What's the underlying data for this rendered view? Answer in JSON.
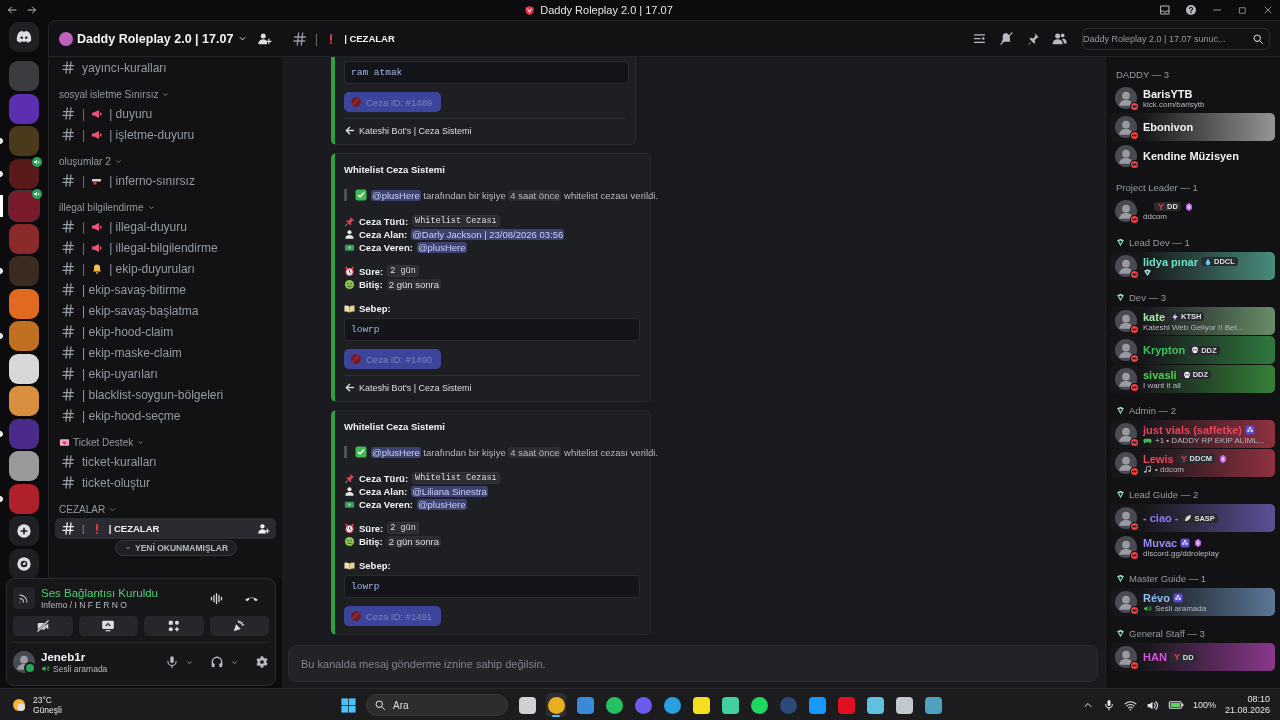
{
  "window": {
    "title": "Daddy Roleplay 2.0 | 17.07"
  },
  "servers": [
    {
      "kind": "home",
      "selected": false,
      "unread": false,
      "voice": false
    },
    {
      "kind": "server",
      "color": "#3c3c40",
      "selected": false,
      "unread": false,
      "voice": false
    },
    {
      "kind": "server",
      "color": "#5b2fb0",
      "selected": false,
      "unread": false,
      "voice": false
    },
    {
      "kind": "server",
      "color": "#4a3a1c",
      "selected": false,
      "unread": true,
      "voice": false
    },
    {
      "kind": "server",
      "color": "#5a1a1a",
      "selected": false,
      "unread": true,
      "voice": true
    },
    {
      "kind": "server",
      "color": "#7a1a2a",
      "selected": true,
      "unread": false,
      "voice": true
    },
    {
      "kind": "server",
      "color": "#8a2a2a",
      "selected": false,
      "unread": false,
      "voice": false
    },
    {
      "kind": "server",
      "color": "#3a2a20",
      "selected": false,
      "unread": true,
      "voice": false
    },
    {
      "kind": "server",
      "color": "#e06a20",
      "selected": false,
      "unread": false,
      "voice": false
    },
    {
      "kind": "server",
      "color": "#c07020",
      "selected": false,
      "unread": true,
      "voice": false
    },
    {
      "kind": "server",
      "color": "#d8d8d8",
      "selected": false,
      "unread": false,
      "voice": false
    },
    {
      "kind": "server",
      "color": "#d89040",
      "selected": false,
      "unread": false,
      "voice": false
    },
    {
      "kind": "server",
      "color": "#4a2a8a",
      "selected": false,
      "unread": true,
      "voice": false
    },
    {
      "kind": "server",
      "color": "#9a9a9a",
      "selected": false,
      "unread": false,
      "voice": false
    },
    {
      "kind": "server",
      "color": "#b0202a",
      "selected": false,
      "unread": true,
      "voice": false
    },
    {
      "kind": "add",
      "selected": false,
      "unread": false,
      "voice": false
    },
    {
      "kind": "discover",
      "selected": false,
      "unread": false,
      "voice": false
    }
  ],
  "channel_sidebar": {
    "server_name": "Daddy Roleplay 2.0 | 17.07",
    "unread_pill": "YENİ OKUNMAMIŞLAR",
    "categories": [
      {
        "channels": [
          {
            "label": "yayıncı-kuralları",
            "selected": false
          }
        ]
      },
      {
        "name": "sosyal isletme Sınırsız",
        "channels": [
          {
            "lead": "|",
            "kind": "megaphone",
            "label": "| duyuru",
            "selected": false
          },
          {
            "lead": "|",
            "kind": "megaphone",
            "label": "| işletme-duyuru",
            "selected": false
          }
        ]
      },
      {
        "name": "oluşumlar 2",
        "channels": [
          {
            "lead": "|",
            "kind": "gun",
            "label": "| inferno-sınırsız",
            "selected": false
          }
        ]
      },
      {
        "name": "illegal bilgilendirme",
        "channels": [
          {
            "lead": "|",
            "kind": "megaphone",
            "label": "| illegal-duyuru",
            "selected": false
          },
          {
            "lead": "|",
            "kind": "megaphone",
            "label": "| illegal-bilgilendirme",
            "selected": false
          },
          {
            "lead": "|",
            "kind": "bell",
            "label": "| ekip-duyuruları",
            "selected": false
          },
          {
            "label": "| ekip-savaş-bitirme",
            "selected": false
          },
          {
            "label": "| ekip-savaş-başlatma",
            "selected": false
          },
          {
            "label": "| ekip-hood-claim",
            "selected": false
          },
          {
            "label": "| ekip-maske-claim",
            "selected": false
          },
          {
            "label": "| ekip-uyarıları",
            "selected": false
          },
          {
            "label": "| blacklist-soygun-bölgeleri",
            "selected": false
          },
          {
            "label": "| ekip-hood-seçme",
            "selected": false
          }
        ]
      },
      {
        "name": "Ticket Destek",
        "kind": "ticket",
        "channels": [
          {
            "label": "ticket-kuralları",
            "selected": false
          },
          {
            "label": "ticket-oluştur",
            "selected": false
          }
        ]
      },
      {
        "name": "CEZALAR",
        "channels": [
          {
            "lead": "|",
            "kind": "exclamation",
            "label": "| CEZALAR",
            "selected": true
          }
        ]
      }
    ]
  },
  "voice_panel": {
    "status": "Ses Bağlantısı Kuruldu",
    "channel": "Inferno / I N F E R N O",
    "buttons": [
      {
        "kind": "camera"
      },
      {
        "kind": "screen"
      },
      {
        "kind": "activities"
      },
      {
        "kind": "soundboard"
      }
    ]
  },
  "user": {
    "name": "Jeneb1r",
    "status": "Sesli aramada"
  },
  "channel_header": {
    "lead": "|",
    "kind": "exclamation",
    "label": "| CEZALAR",
    "search_placeholder": "Daddy Roleplay 2.0 | 17.07 sunuc..."
  },
  "messages": [
    {
      "code_block": "ram atmak",
      "case_id": "Ceza ID: #1489",
      "footer": "Kateshi Bot's | Ceza Sistemi"
    },
    {
      "title": "Whitelist Ceza Sistemi",
      "summary": [
        {
          "kind": "mention",
          "text": "@plusHere"
        },
        {
          "kind": "text",
          "text": " tarafından bir kişiye "
        },
        {
          "kind": "code",
          "text": "4 saat önce"
        },
        {
          "kind": "text",
          "text": " whitelist cezası verildi."
        }
      ],
      "field_groups": [
        [
          {
            "label": "Ceza Türü:",
            "value": "Whitelist Cezası",
            "kind": "code"
          },
          {
            "label": "Ceza Alan:",
            "value": "@Darly Jackson | 23/08/2026 03:56",
            "kind": "mention"
          },
          {
            "label": "Ceza Veren:",
            "value": "@plusHere",
            "kind": "mention"
          }
        ],
        [
          {
            "label": "Süre:",
            "value": "2 gün",
            "kind": "code"
          },
          {
            "label": "Bitiş:",
            "value": "2 gün sonra",
            "kind": "timestamp"
          }
        ]
      ],
      "reason_label": "Sebep:",
      "code_block": "lowrp",
      "case_id": "Ceza ID: #1490",
      "footer": "Kateshi Bot's | Ceza Sistemi"
    },
    {
      "title": "Whitelist Ceza Sistemi",
      "summary": [
        {
          "kind": "mention",
          "text": "@plusHere"
        },
        {
          "kind": "text",
          "text": " tarafından bir kişiye "
        },
        {
          "kind": "code",
          "text": "4 saat önce"
        },
        {
          "kind": "text",
          "text": " whitelist cezası verildi."
        }
      ],
      "field_groups": [
        [
          {
            "label": "Ceza Türü:",
            "value": "Whitelist Cezası",
            "kind": "code"
          },
          {
            "label": "Ceza Alan:",
            "value": "@Liliana Sinestra",
            "kind": "mention"
          },
          {
            "label": "Ceza Veren:",
            "value": "@plusHere",
            "kind": "mention"
          }
        ],
        [
          {
            "label": "Süre:",
            "value": "2 gün",
            "kind": "code"
          },
          {
            "label": "Bitiş:",
            "value": "2 gün sonra",
            "kind": "timestamp"
          }
        ]
      ],
      "reason_label": "Sebep:",
      "code_block": "lowrp",
      "case_id": "Ceza ID: #1491"
    }
  ],
  "message_input": {
    "placeholder": "Bu kanalda mesaj gönderme iznine sahip değilsin.",
    "disabled": true
  },
  "member_groups": [
    {
      "title": "DADDY — 3",
      "kind": "plain",
      "members": [
        {
          "name": "BarisYTB",
          "color": "#f2f3f5",
          "activity": {
            "text": "kick.com/barisytb"
          },
          "banner": false
        },
        {
          "name": "Ebonivon",
          "color": "#f2f3f5",
          "banner": true
        },
        {
          "name": "Kendine Müzisyen",
          "color": "#f2f3f5",
          "banner": false
        }
      ]
    },
    {
      "title": "Project Leader — 1",
      "kind": "plain",
      "members": [
        {
          "tag": {
            "text": "DD",
            "kind": "y"
          },
          "icons": [
            {
              "kind": "boost"
            }
          ],
          "activity": {
            "text": "ddcom"
          },
          "banner": false
        }
      ]
    },
    {
      "title": "Lead Dev — 1",
      "kind": "role",
      "members": [
        {
          "name": "lidya pınar",
          "color": "#6fe3c8",
          "tag": {
            "text": "DDCL",
            "kind": "drop"
          },
          "activity": {
            "kind": "role"
          },
          "banner": true
        }
      ]
    },
    {
      "title": "Dev — 3",
      "kind": "role",
      "members": [
        {
          "name": "kate",
          "color": "#a6e6a6",
          "tag": {
            "text": "KTSH",
            "kind": "bolt"
          },
          "activity": {
            "text": "Kateshi Web Geliyor !! Bet..."
          },
          "banner": true
        },
        {
          "name": "Krypton",
          "color": "#3fc25a",
          "tag": {
            "text": "DDZ",
            "kind": "skull"
          },
          "banner": true
        },
        {
          "name": "sivasli",
          "color": "#4ed04e",
          "tag": {
            "text": "DDZ",
            "kind": "skull"
          },
          "activity": {
            "text": "I want it all"
          },
          "banner": true
        }
      ]
    },
    {
      "title": "Admin — 2",
      "kind": "role",
      "members": [
        {
          "name": "just vials (saffetke)",
          "color": "#e8455c",
          "icons": [
            {
              "kind": "clan"
            }
          ],
          "activity": {
            "kind": "game",
            "text": "+1 • DADDY RP EKİP ALIML..."
          },
          "banner": true
        },
        {
          "name": "Lewis",
          "color": "#e8455c",
          "tag": {
            "text": "DDCM",
            "kind": "y"
          },
          "icons": [
            {
              "kind": "boost"
            }
          ],
          "activity": {
            "kind": "music",
            "text": "• ddcom"
          },
          "banner": true
        }
      ]
    },
    {
      "title": "Lead Guide — 2",
      "kind": "role",
      "members": [
        {
          "name": "- ciao -",
          "color": "#8f7cf5",
          "tag": {
            "text": "SASP",
            "kind": "leaf"
          },
          "banner": true
        },
        {
          "name": "Muvac",
          "color": "#9a8af5",
          "icons": [
            {
              "kind": "clan"
            },
            {
              "kind": "boost"
            }
          ],
          "activity": {
            "text": "discord.gg/ddroleplay"
          },
          "banner": false
        }
      ]
    },
    {
      "title": "Master Guide — 1",
      "kind": "role",
      "members": [
        {
          "name": "Révo",
          "color": "#8fbff5",
          "icons": [
            {
              "kind": "clan"
            }
          ],
          "activity": {
            "kind": "voice",
            "text": "Sesli aramada"
          },
          "banner": true
        }
      ]
    },
    {
      "title": "General Staff — 3",
      "kind": "role",
      "members": [
        {
          "name": "HAN",
          "color": "#e050e0",
          "tag": {
            "text": "DD",
            "kind": "y"
          },
          "banner": true
        }
      ]
    }
  ],
  "taskbar": {
    "weather_temp": "23°C",
    "weather_text": "Güneşli",
    "search_placeholder": "Ara",
    "apps": [
      {
        "kind": "taskview",
        "color": "#d0d0d0",
        "selected": false
      },
      {
        "kind": "chrome",
        "color": "#e8b020",
        "selected": true
      },
      {
        "kind": "photos",
        "color": "#3a8ad8",
        "selected": false
      },
      {
        "kind": "whatsapp",
        "color": "#25c060",
        "selected": false
      },
      {
        "kind": "discord",
        "color": "#6a5af0",
        "selected": false
      },
      {
        "kind": "telegram",
        "color": "#2aa0e0",
        "selected": false
      },
      {
        "kind": "snapchat",
        "color": "#f5e020",
        "selected": false
      },
      {
        "kind": "game",
        "color": "#40d0a0",
        "selected": false
      },
      {
        "kind": "spotify",
        "color": "#1ed760",
        "selected": false
      },
      {
        "kind": "steam",
        "color": "#2a4a7a",
        "selected": false
      },
      {
        "kind": "prime",
        "color": "#1a98ff",
        "selected": false
      },
      {
        "kind": "netflix",
        "color": "#e01020",
        "selected": false
      },
      {
        "kind": "notepad",
        "color": "#60c0e0",
        "selected": false
      },
      {
        "kind": "keyboard",
        "color": "#c0c8d0",
        "selected": false
      },
      {
        "kind": "tool",
        "color": "#50a0c0",
        "selected": false
      }
    ],
    "battery": "100%",
    "time": "08:10",
    "date": "21.08.2026"
  }
}
